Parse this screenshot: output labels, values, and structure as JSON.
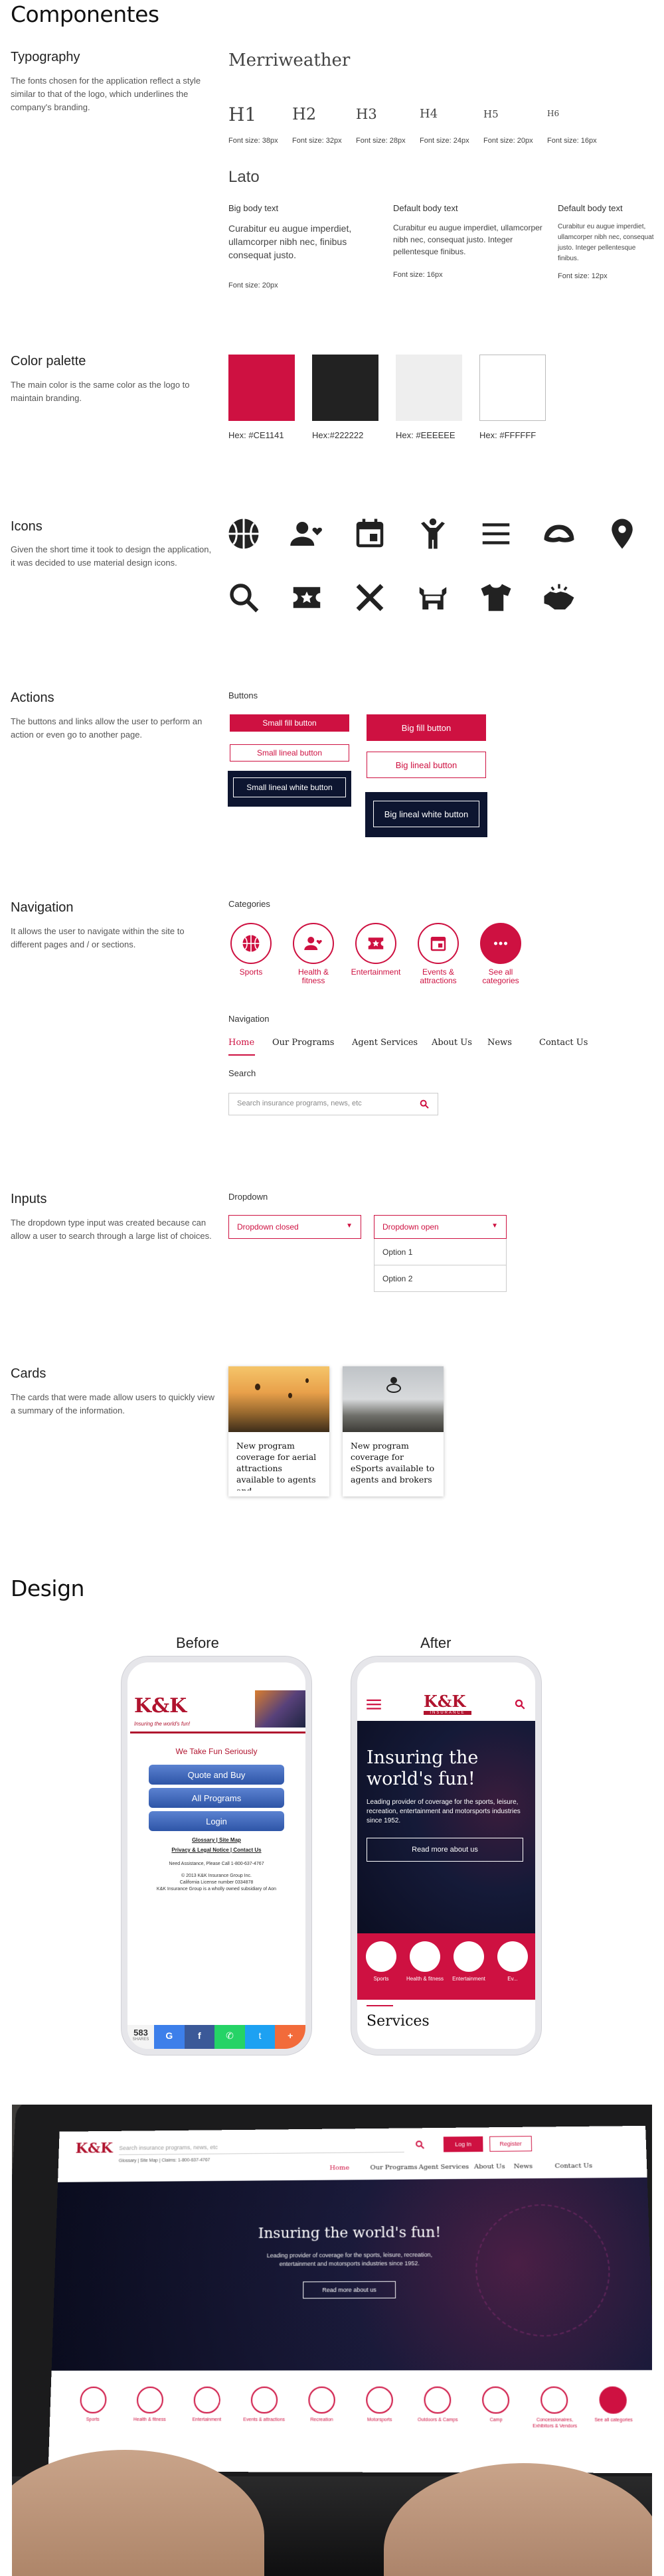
{
  "components_title": "Componentes",
  "typography": {
    "title": "Typography",
    "desc": "The fonts chosen for the application reflect a style similar to that of the logo, which underlines the company's branding.",
    "serif_name": "Merriweather",
    "headings": [
      {
        "label": "H1",
        "size": "Font size: 38px"
      },
      {
        "label": "H2",
        "size": "Font size: 32px"
      },
      {
        "label": "H3",
        "size": "Font size: 28px"
      },
      {
        "label": "H4",
        "size": "Font size: 24px"
      },
      {
        "label": "H5",
        "size": "Font size: 20px"
      },
      {
        "label": "H6",
        "size": "Font size: 16px"
      }
    ],
    "sans_name": "Lato",
    "body": [
      {
        "title": "Big body text",
        "text": "Curabitur eu augue imperdiet, ullamcorper nibh nec, finibus consequat justo.",
        "size": "Font size: 20px"
      },
      {
        "title": "Default body text",
        "text": "Curabitur eu augue imperdiet, ullamcorper nibh nec, consequat justo. Integer pellentesque finibus.",
        "size": "Font size: 16px"
      },
      {
        "title": "Default body text",
        "text": "Curabitur eu augue imperdiet, ullamcorper nibh nec, consequat justo. Integer pellentesque finibus.",
        "size": "Font size: 12px"
      }
    ]
  },
  "palette": {
    "title": "Color palette",
    "desc": "The main color is the same color as the logo to maintain branding.",
    "colors": [
      {
        "hex": "#CE1141",
        "label": "Hex: #CE1141"
      },
      {
        "hex": "#222222",
        "label": "Hex:#222222"
      },
      {
        "hex": "#EEEEEE",
        "label": "Hex: #EEEEEE"
      },
      {
        "hex": "#FFFFFF",
        "label": "Hex: #FFFFFF"
      }
    ]
  },
  "icons": {
    "title": "Icons",
    "desc": "Given the short time it took to design the application, it was decided to use material design icons.",
    "row1": [
      "basketball-icon",
      "person-heart-icon",
      "calendar-icon",
      "person-arms-up-icon",
      "menu-icon",
      "cap-icon",
      "location-pin-icon"
    ],
    "row2": [
      "search-icon",
      "ticket-star-icon",
      "close-icon",
      "stadium-icon",
      "tshirt-icon",
      "handshake-icon"
    ]
  },
  "actions": {
    "title": "Actions",
    "desc": "The buttons and links allow the user to perform an action or even go to another page.",
    "buttons_label": "Buttons",
    "small_fill": "Small fill button",
    "small_lineal": "Small lineal button",
    "small_white": "Small lineal white button",
    "big_fill": "Big fill button",
    "big_lineal": "Big lineal button",
    "big_white": "Big lineal white button"
  },
  "navigation": {
    "title": "Navigation",
    "desc": "It allows the user to navigate within the site to different pages and / or sections.",
    "categories_label": "Categories",
    "categories": [
      "Sports",
      "Health & fitness",
      "Entertainment",
      "Events & attractions",
      "See all categories"
    ],
    "nav_label": "Navigation",
    "nav_items": [
      "Home",
      "Our Programs",
      "Agent Services",
      "About Us",
      "News",
      "Contact Us"
    ],
    "search_label": "Search",
    "search_placeholder": "Search insurance programs, news, etc"
  },
  "inputs": {
    "title": "Inputs",
    "desc": "The dropdown type input was created because can allow a user to search through a large list of choices.",
    "dropdown_label": "Dropdown",
    "closed": "Dropdown closed",
    "open": "Dropdown open",
    "options": [
      "Option 1",
      "Option 2"
    ]
  },
  "cards": {
    "title": "Cards",
    "desc": "The cards that were made allow users to quickly view a summary of the information.",
    "items": [
      "New program coverage for aerial attractions available to agents and",
      "New program coverage for eSports available to agents and brokers"
    ]
  },
  "design": {
    "title": "Design",
    "before": "Before",
    "after": "After",
    "old_logo": "K&K",
    "old_tag": "Insuring the world's fun!",
    "old_fun": "We Take Fun Seriously",
    "old_buttons": [
      "Quote and Buy",
      "All Programs",
      "Login"
    ],
    "old_links1": "Glossary | Site Map",
    "old_links2": "Privacy & Legal Notice | Contact Us",
    "old_small": [
      "Need Assistance, Please Call 1-800-637-4767",
      "© 2013 K&K Insurance Group Inc.",
      "California License number 0334878",
      "K&K Insurance Group is a wholly owned subsidiary of Aon"
    ],
    "old_share_count": "583",
    "old_share_label": "SHARES",
    "new_logo": "K&K",
    "new_logo_sub": "INSURANCE",
    "new_hero": "Insuring the world's fun!",
    "new_hero_sub": "Leading provider of coverage for the sports, leisure, recreation, entertainment and motorsports industries since 1952.",
    "new_read_more": "Read more about us",
    "new_cats": [
      "Sports",
      "Health & fitness",
      "Entertainment",
      "Ev..."
    ],
    "new_services": "Services"
  },
  "laptop": {
    "logo": "K&K",
    "search_placeholder": "Search insurance programs, news, etc",
    "top_links": "Glossary | Site Map | Claims: 1-800-637-4767",
    "login": "Log In",
    "register": "Register",
    "nav": [
      "Home",
      "Our Programs",
      "Agent Services",
      "About Us",
      "News",
      "Contact Us"
    ],
    "hero": "Insuring the world's fun!",
    "hero_sub": "Leading provider of coverage for the sports, leisure, recreation, entertainment and motorsports industries since 1952.",
    "read_more": "Read more about us",
    "cats": [
      "Sports",
      "Health & fitness",
      "Entertainment",
      "Events & attractions",
      "Recreation",
      "Motorsports",
      "Outdoors & Camps",
      "Camp",
      "Concessionaires, Exhibitors & Vendors",
      "See all categories"
    ]
  },
  "colors": {
    "accent": "#CE1141",
    "dark": "#222222",
    "navy": "#0d1530",
    "blue_btn": "#3b62b5"
  }
}
